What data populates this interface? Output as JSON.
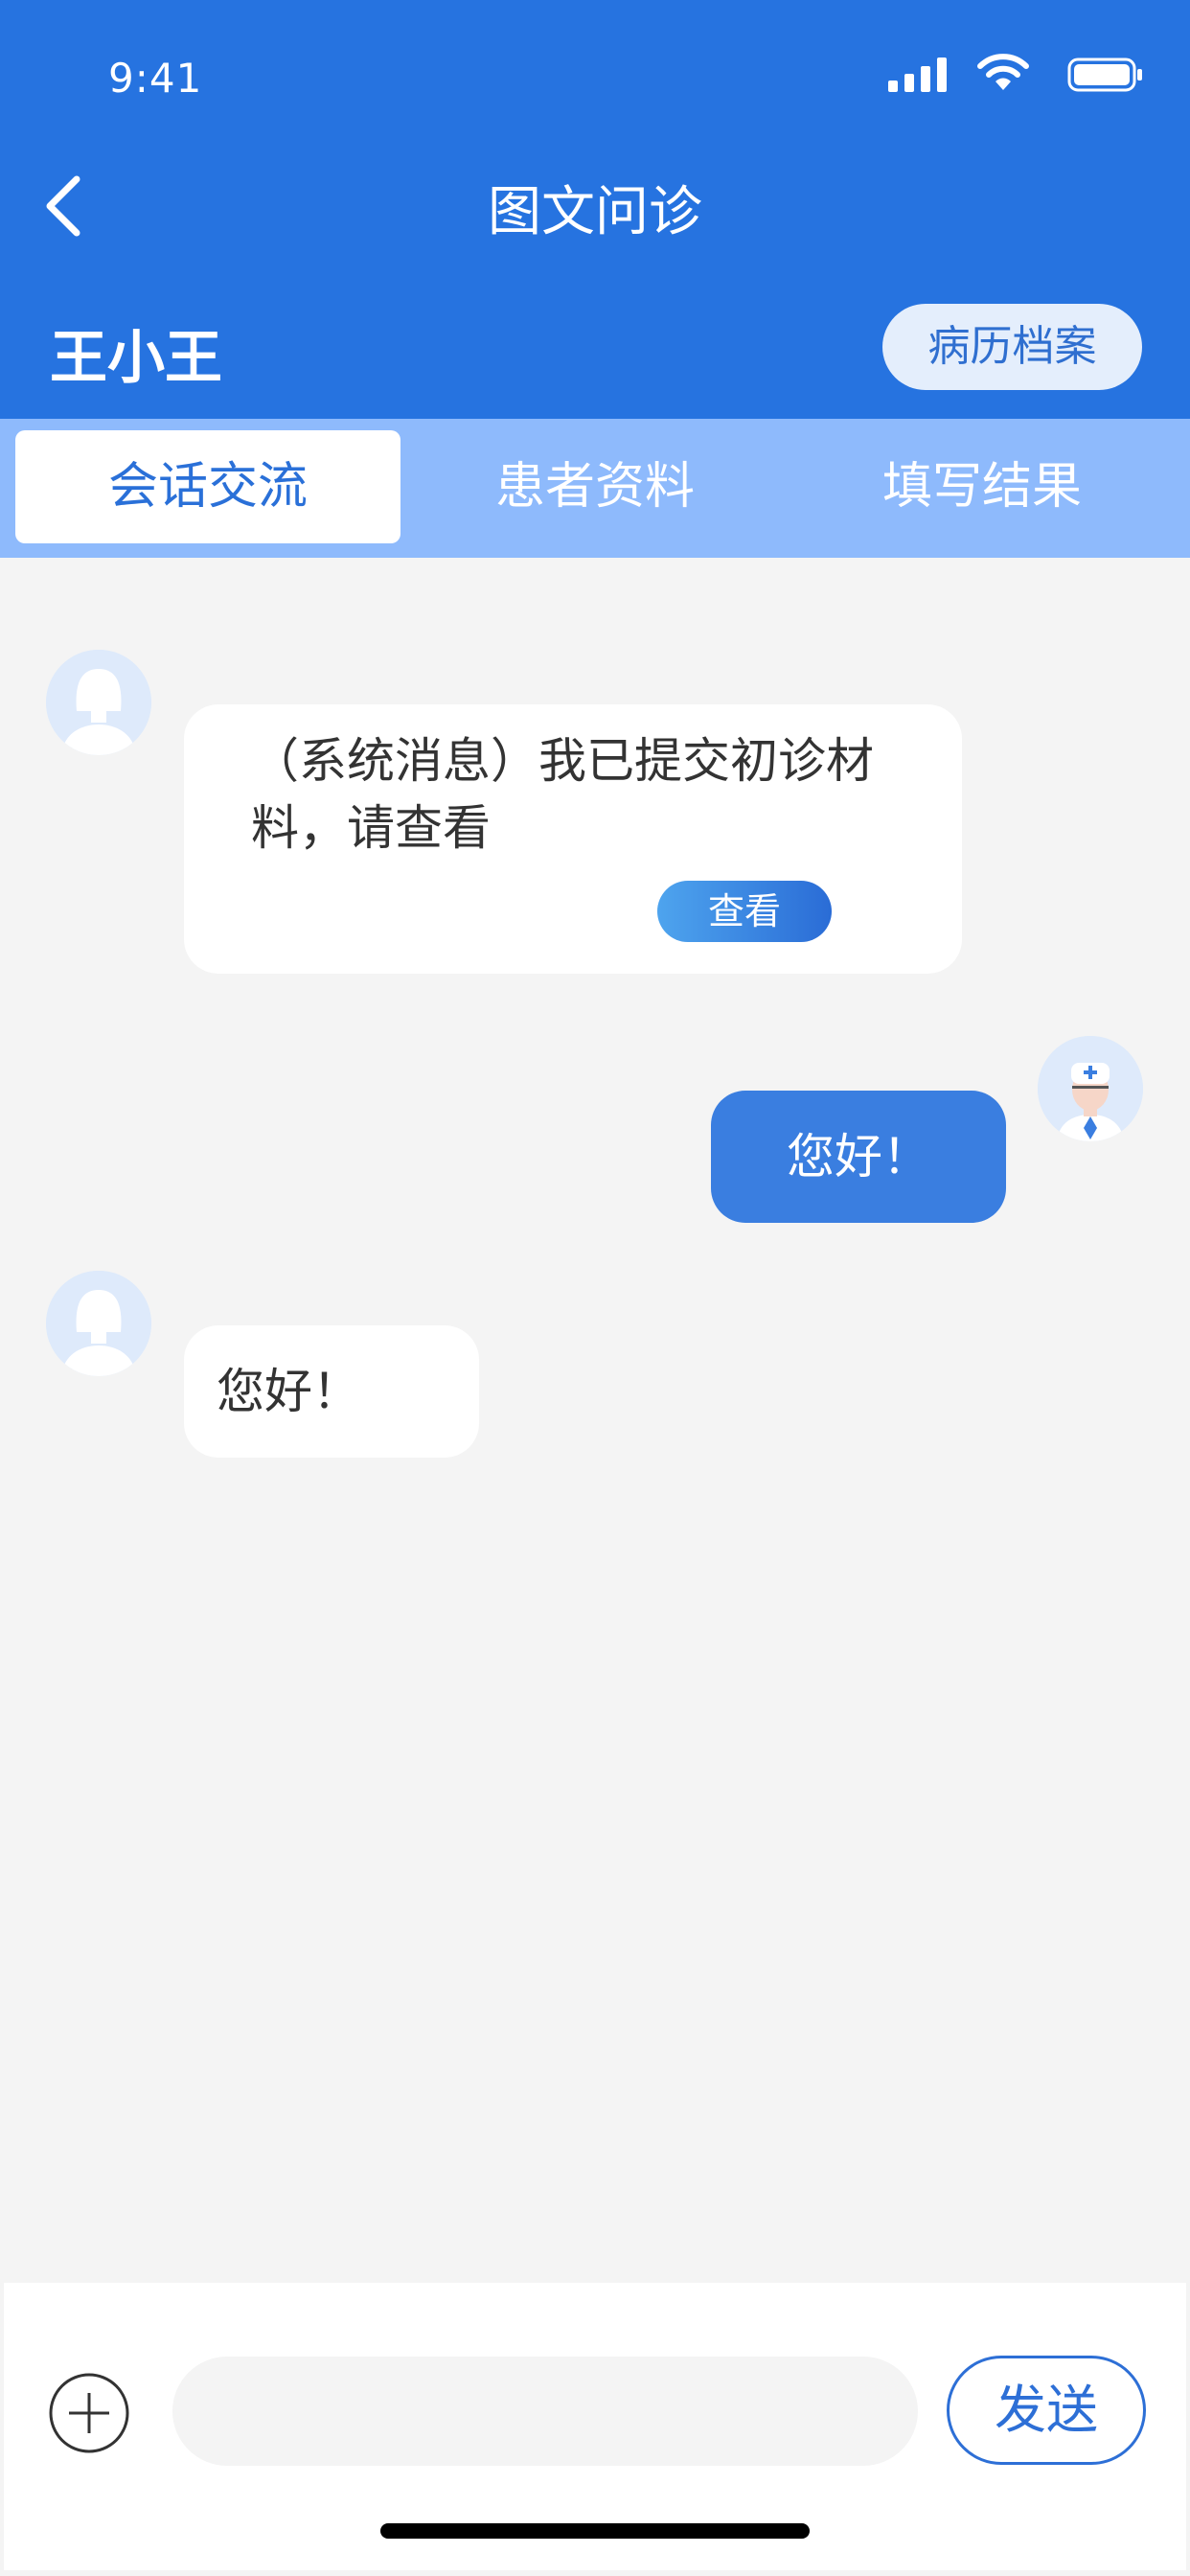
{
  "status_bar": {
    "time": "9:41",
    "icons": [
      "signal-icon",
      "wifi-icon",
      "battery-icon"
    ]
  },
  "nav": {
    "back_icon": "chevron-left-icon",
    "title": "图文问诊"
  },
  "patient": {
    "name": "王小王",
    "records_button": "病历档案"
  },
  "tabs": [
    {
      "label": "会话交流",
      "active": true
    },
    {
      "label": "患者资料",
      "active": false
    },
    {
      "label": "填写结果",
      "active": false
    }
  ],
  "messages": [
    {
      "from": "patient",
      "type": "system",
      "text": "（系统消息）我已提交初诊材料，请查看",
      "action": "查看"
    },
    {
      "from": "doctor",
      "type": "text",
      "text": "您好！"
    },
    {
      "from": "patient",
      "type": "text",
      "text": "您好！"
    }
  ],
  "input_bar": {
    "add_icon": "plus-circle-icon",
    "placeholder": "",
    "send_label": "发送"
  },
  "colors": {
    "primary": "#2673e0",
    "tab_bar": "#8ebafc",
    "bubble_out": "#3a7ee0",
    "background": "#f4f4f4"
  }
}
